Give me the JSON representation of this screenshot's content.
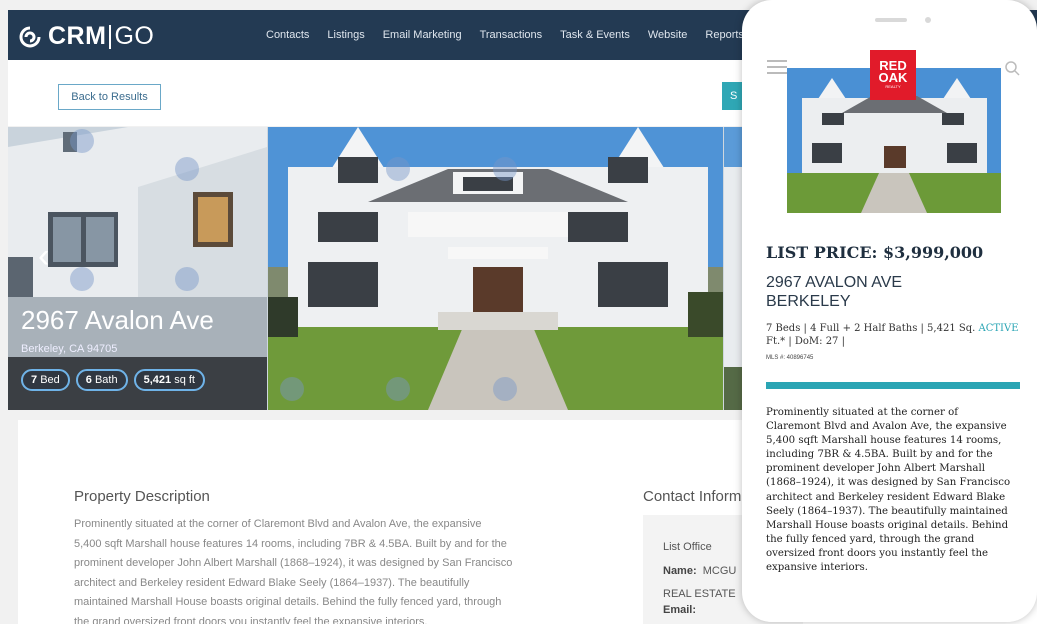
{
  "brand": {
    "name_bold": "CRM",
    "name_light": "GO"
  },
  "nav": [
    "Contacts",
    "Listings",
    "Email Marketing",
    "Transactions",
    "Task & Events",
    "Website",
    "Reports"
  ],
  "subbar": {
    "back_label": "Back to Results",
    "teal_label": "S"
  },
  "hero": {
    "address": "2967 Avalon Ave",
    "city_line": "Berkeley, CA 94705",
    "beds_num": "7",
    "beds_unit": "Bed",
    "baths_num": "6",
    "baths_unit": "Bath",
    "sqft_num": "5,421",
    "sqft_unit": "sq ft"
  },
  "description": {
    "heading": "Property Description",
    "lines": [
      "Prominently situated at the corner of Claremont Blvd and Avalon Ave, the expansive",
      "5,400 sqft Marshall house features 14 rooms, including 7BR & 4.5BA. Built by and for the",
      "prominent developer John Albert Marshall (1868–1924), it was designed by San Francisco",
      "architect and Berkeley resident Edward Blake Seely (1864–1937). The beautifully",
      "maintained Marshall House boasts original details. Behind the fully fenced yard, through",
      "the grand oversized front doors you instantly feel the expansive interiors."
    ]
  },
  "contact": {
    "heading": "Contact Inform",
    "list_office": "List Office",
    "name_label": "Name:",
    "name_value": "MCGU",
    "company_line": "REAL ESTATE",
    "email_label": "Email:"
  },
  "mobile": {
    "logo_line1": "RED",
    "logo_line2": "OAK",
    "logo_small": "REALTY",
    "price": "LIST PRICE: $3,999,000",
    "address_line1": "2967 AVALON AVE",
    "address_line2": "BERKELEY",
    "details_line1": "7 Beds | 4 Full + 2 Half Baths | 5,421 Sq.",
    "status": "ACTIVE",
    "details_line2": "Ft.* | DoM: 27 |",
    "mls": "MLS #: 40896745",
    "description_lines": [
      "Prominently situated at the corner of",
      "Claremont Blvd and Avalon Ave, the expansive",
      "5,400 sqft Marshall house features 14 rooms,",
      "including 7BR & 4.5BA. Built by and for the",
      "prominent developer John Albert Marshall",
      "(1868–1924), it was designed by San Francisco",
      "architect and Berkeley resident Edward Blake",
      "Seely (1864–1937). The beautifully maintained",
      "Marshall House boasts original details. Behind",
      "the fully fenced yard, through the grand",
      "oversized front doors you instantly feel the",
      "expansive interiors."
    ]
  },
  "colors": {
    "header": "#233a53",
    "accent": "#2aa5b4",
    "pill_border": "#6fb3e8",
    "logo_red": "#e11b2a"
  },
  "icons": {
    "logo": "crm-logo-icon",
    "prev": "chevron-left-icon",
    "menu": "hamburger-icon",
    "search": "search-icon"
  }
}
